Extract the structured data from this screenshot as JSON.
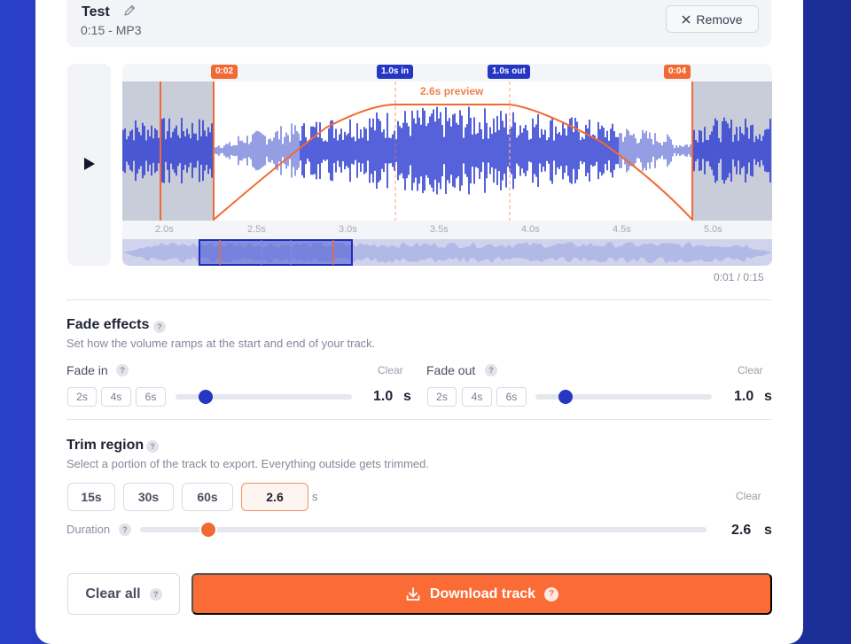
{
  "track": {
    "name": "Test",
    "meta": "0:15 - MP3",
    "remove_label": "Remove"
  },
  "waveform": {
    "markers": {
      "start": "0:02",
      "fade_in": "1.0s in",
      "fade_out": "1.0s out",
      "end": "0:04"
    },
    "preview_label": "2.6s preview",
    "ticks": [
      "2.0s",
      "2.5s",
      "3.0s",
      "3.5s",
      "4.0s",
      "4.5s",
      "5.0s"
    ],
    "time_readout": "0:01 / 0:15"
  },
  "fade": {
    "title": "Fade effects",
    "description": "Set how the volume ramps at the start and end of your track.",
    "fade_in": {
      "label": "Fade in",
      "clear": "Clear",
      "presets": [
        "2s",
        "4s",
        "6s"
      ],
      "value": "1.0",
      "unit": "s",
      "level": 0.17
    },
    "fade_out": {
      "label": "Fade out",
      "clear": "Clear",
      "presets": [
        "2s",
        "4s",
        "6s"
      ],
      "value": "1.0",
      "unit": "s",
      "level": 0.17
    }
  },
  "trim": {
    "title": "Trim region",
    "description": "Select a portion of the track to export. Everything outside gets trimmed.",
    "presets": [
      "15s",
      "30s",
      "60s"
    ],
    "custom_value": "2.6",
    "custom_unit": "s",
    "clear": "Clear",
    "duration_label": "Duration",
    "duration_value": "2.6",
    "duration_unit": "s",
    "duration_level": 0.12
  },
  "actions": {
    "clear_all": "Clear all",
    "download": "Download track"
  },
  "help_glyph": "?",
  "colors": {
    "accent_orange": "#fb6b35",
    "accent_blue": "#2535c4",
    "background": "#2238b0"
  }
}
